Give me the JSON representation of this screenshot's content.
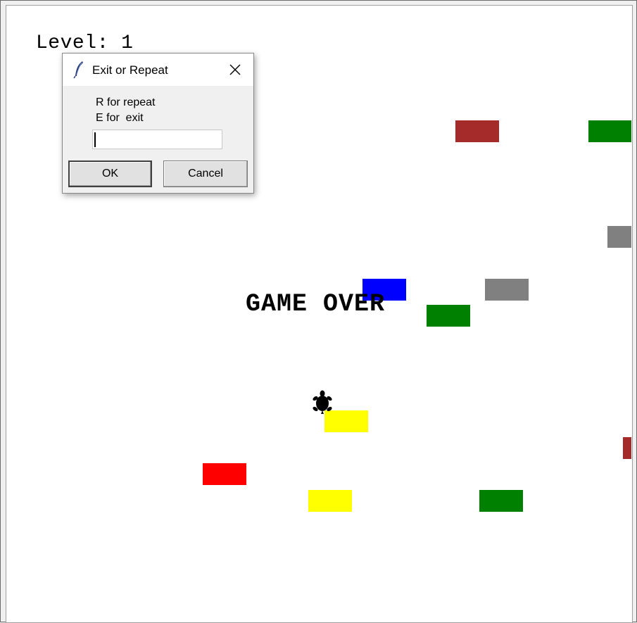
{
  "game": {
    "level_text": "Level: 1",
    "game_over_text": "GAME OVER",
    "blocks": [
      {
        "name": "block-brown-1",
        "color": "#a52a2a"
      },
      {
        "name": "block-green-1",
        "color": "#008000"
      },
      {
        "name": "block-gray-1",
        "color": "#808080"
      },
      {
        "name": "block-blue-1",
        "color": "#0000ff"
      },
      {
        "name": "block-gray-2",
        "color": "#808080"
      },
      {
        "name": "block-green-2",
        "color": "#008000"
      },
      {
        "name": "block-yellow-1",
        "color": "#ffff00"
      },
      {
        "name": "block-brown-2",
        "color": "#a52a2a"
      },
      {
        "name": "block-red-1",
        "color": "#ff0000"
      },
      {
        "name": "block-yellow-2",
        "color": "#ffff00"
      },
      {
        "name": "block-green-3",
        "color": "#008000"
      }
    ],
    "player_icon": "turtle-icon"
  },
  "dialog": {
    "title": "Exit or Repeat",
    "app_icon": "feather-icon",
    "close_icon": "close-icon",
    "prompt_line1": "R for repeat",
    "prompt_line2": "E for  exit",
    "input_value": "",
    "ok_label": "OK",
    "cancel_label": "Cancel"
  }
}
